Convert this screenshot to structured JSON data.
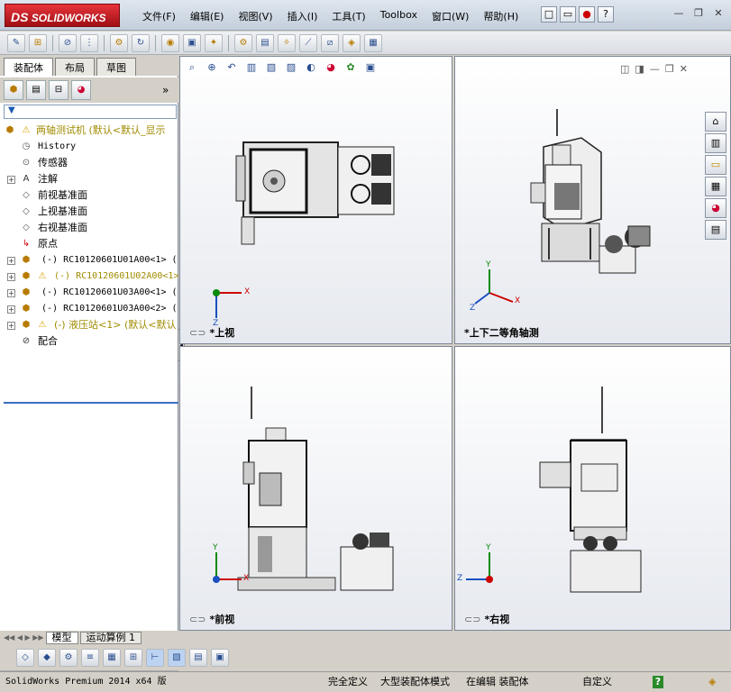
{
  "app": {
    "logo_ds": "DS",
    "logo_text": "SOLIDWORKS"
  },
  "menu": [
    "文件(F)",
    "编辑(E)",
    "视图(V)",
    "插入(I)",
    "工具(T)",
    "Toolbox",
    "窗口(W)",
    "帮助(H)"
  ],
  "left_tabs": [
    "装配体",
    "布局",
    "草图"
  ],
  "tree": {
    "root": "两轴测试机  (默认<默认_显示",
    "items": [
      {
        "label": "History",
        "icon": "history-icon"
      },
      {
        "label": "传感器",
        "icon": "sensor-icon"
      },
      {
        "label": "注解",
        "icon": "annotation-icon"
      },
      {
        "label": "前视基准面",
        "icon": "plane-icon"
      },
      {
        "label": "上视基准面",
        "icon": "plane-icon"
      },
      {
        "label": "右视基准面",
        "icon": "plane-icon"
      },
      {
        "label": "原点",
        "icon": "origin-icon"
      },
      {
        "label": "(-) RC10120601U01A00<1> (",
        "icon": "component-icon"
      },
      {
        "label": "(-) RC10120601U02A00<1>",
        "icon": "warning-icon"
      },
      {
        "label": "(-) RC10120601U03A00<1> (",
        "icon": "component-icon"
      },
      {
        "label": "(-) RC10120601U03A00<2> (",
        "icon": "component-icon"
      },
      {
        "label": "(-) 液压站<1> (默认<默认",
        "icon": "warning-icon"
      },
      {
        "label": "配合",
        "icon": "mate-icon"
      }
    ]
  },
  "bottom_tabs": [
    "模型",
    "运动算例 1"
  ],
  "viewports": {
    "top": "*上视",
    "iso": "*上下二等角轴测",
    "front": "*前视",
    "right": "*右视"
  },
  "axes": {
    "x": "X",
    "y": "Y",
    "z": "Z"
  },
  "status": {
    "version": "SolidWorks Premium 2014 x64 版",
    "fully_defined": "完全定义",
    "large_assembly": "大型装配体模式",
    "editing": "在编辑 装配体",
    "custom": "自定义",
    "help": "?"
  }
}
